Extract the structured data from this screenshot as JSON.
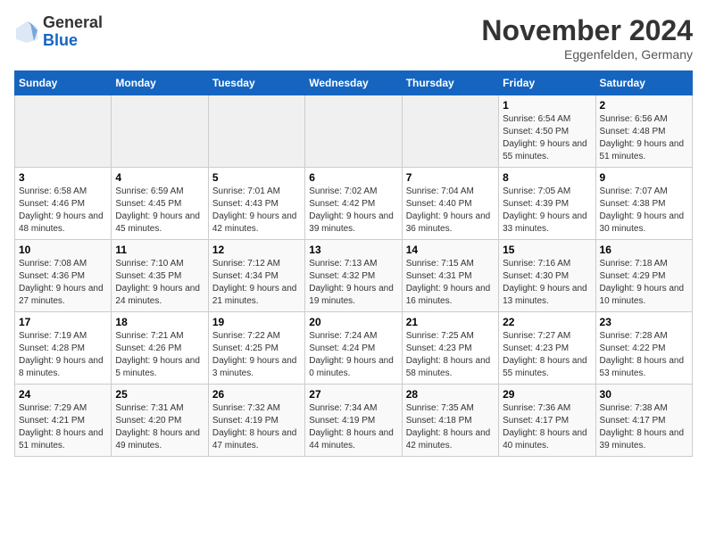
{
  "header": {
    "logo_general": "General",
    "logo_blue": "Blue",
    "month_title": "November 2024",
    "location": "Eggenfelden, Germany"
  },
  "calendar": {
    "days_of_week": [
      "Sunday",
      "Monday",
      "Tuesday",
      "Wednesday",
      "Thursday",
      "Friday",
      "Saturday"
    ],
    "weeks": [
      [
        {
          "day": "",
          "sunrise": "",
          "sunset": "",
          "daylight": ""
        },
        {
          "day": "",
          "sunrise": "",
          "sunset": "",
          "daylight": ""
        },
        {
          "day": "",
          "sunrise": "",
          "sunset": "",
          "daylight": ""
        },
        {
          "day": "",
          "sunrise": "",
          "sunset": "",
          "daylight": ""
        },
        {
          "day": "",
          "sunrise": "",
          "sunset": "",
          "daylight": ""
        },
        {
          "day": "1",
          "sunrise": "Sunrise: 6:54 AM",
          "sunset": "Sunset: 4:50 PM",
          "daylight": "Daylight: 9 hours and 55 minutes."
        },
        {
          "day": "2",
          "sunrise": "Sunrise: 6:56 AM",
          "sunset": "Sunset: 4:48 PM",
          "daylight": "Daylight: 9 hours and 51 minutes."
        }
      ],
      [
        {
          "day": "3",
          "sunrise": "Sunrise: 6:58 AM",
          "sunset": "Sunset: 4:46 PM",
          "daylight": "Daylight: 9 hours and 48 minutes."
        },
        {
          "day": "4",
          "sunrise": "Sunrise: 6:59 AM",
          "sunset": "Sunset: 4:45 PM",
          "daylight": "Daylight: 9 hours and 45 minutes."
        },
        {
          "day": "5",
          "sunrise": "Sunrise: 7:01 AM",
          "sunset": "Sunset: 4:43 PM",
          "daylight": "Daylight: 9 hours and 42 minutes."
        },
        {
          "day": "6",
          "sunrise": "Sunrise: 7:02 AM",
          "sunset": "Sunset: 4:42 PM",
          "daylight": "Daylight: 9 hours and 39 minutes."
        },
        {
          "day": "7",
          "sunrise": "Sunrise: 7:04 AM",
          "sunset": "Sunset: 4:40 PM",
          "daylight": "Daylight: 9 hours and 36 minutes."
        },
        {
          "day": "8",
          "sunrise": "Sunrise: 7:05 AM",
          "sunset": "Sunset: 4:39 PM",
          "daylight": "Daylight: 9 hours and 33 minutes."
        },
        {
          "day": "9",
          "sunrise": "Sunrise: 7:07 AM",
          "sunset": "Sunset: 4:38 PM",
          "daylight": "Daylight: 9 hours and 30 minutes."
        }
      ],
      [
        {
          "day": "10",
          "sunrise": "Sunrise: 7:08 AM",
          "sunset": "Sunset: 4:36 PM",
          "daylight": "Daylight: 9 hours and 27 minutes."
        },
        {
          "day": "11",
          "sunrise": "Sunrise: 7:10 AM",
          "sunset": "Sunset: 4:35 PM",
          "daylight": "Daylight: 9 hours and 24 minutes."
        },
        {
          "day": "12",
          "sunrise": "Sunrise: 7:12 AM",
          "sunset": "Sunset: 4:34 PM",
          "daylight": "Daylight: 9 hours and 21 minutes."
        },
        {
          "day": "13",
          "sunrise": "Sunrise: 7:13 AM",
          "sunset": "Sunset: 4:32 PM",
          "daylight": "Daylight: 9 hours and 19 minutes."
        },
        {
          "day": "14",
          "sunrise": "Sunrise: 7:15 AM",
          "sunset": "Sunset: 4:31 PM",
          "daylight": "Daylight: 9 hours and 16 minutes."
        },
        {
          "day": "15",
          "sunrise": "Sunrise: 7:16 AM",
          "sunset": "Sunset: 4:30 PM",
          "daylight": "Daylight: 9 hours and 13 minutes."
        },
        {
          "day": "16",
          "sunrise": "Sunrise: 7:18 AM",
          "sunset": "Sunset: 4:29 PM",
          "daylight": "Daylight: 9 hours and 10 minutes."
        }
      ],
      [
        {
          "day": "17",
          "sunrise": "Sunrise: 7:19 AM",
          "sunset": "Sunset: 4:28 PM",
          "daylight": "Daylight: 9 hours and 8 minutes."
        },
        {
          "day": "18",
          "sunrise": "Sunrise: 7:21 AM",
          "sunset": "Sunset: 4:26 PM",
          "daylight": "Daylight: 9 hours and 5 minutes."
        },
        {
          "day": "19",
          "sunrise": "Sunrise: 7:22 AM",
          "sunset": "Sunset: 4:25 PM",
          "daylight": "Daylight: 9 hours and 3 minutes."
        },
        {
          "day": "20",
          "sunrise": "Sunrise: 7:24 AM",
          "sunset": "Sunset: 4:24 PM",
          "daylight": "Daylight: 9 hours and 0 minutes."
        },
        {
          "day": "21",
          "sunrise": "Sunrise: 7:25 AM",
          "sunset": "Sunset: 4:23 PM",
          "daylight": "Daylight: 8 hours and 58 minutes."
        },
        {
          "day": "22",
          "sunrise": "Sunrise: 7:27 AM",
          "sunset": "Sunset: 4:23 PM",
          "daylight": "Daylight: 8 hours and 55 minutes."
        },
        {
          "day": "23",
          "sunrise": "Sunrise: 7:28 AM",
          "sunset": "Sunset: 4:22 PM",
          "daylight": "Daylight: 8 hours and 53 minutes."
        }
      ],
      [
        {
          "day": "24",
          "sunrise": "Sunrise: 7:29 AM",
          "sunset": "Sunset: 4:21 PM",
          "daylight": "Daylight: 8 hours and 51 minutes."
        },
        {
          "day": "25",
          "sunrise": "Sunrise: 7:31 AM",
          "sunset": "Sunset: 4:20 PM",
          "daylight": "Daylight: 8 hours and 49 minutes."
        },
        {
          "day": "26",
          "sunrise": "Sunrise: 7:32 AM",
          "sunset": "Sunset: 4:19 PM",
          "daylight": "Daylight: 8 hours and 47 minutes."
        },
        {
          "day": "27",
          "sunrise": "Sunrise: 7:34 AM",
          "sunset": "Sunset: 4:19 PM",
          "daylight": "Daylight: 8 hours and 44 minutes."
        },
        {
          "day": "28",
          "sunrise": "Sunrise: 7:35 AM",
          "sunset": "Sunset: 4:18 PM",
          "daylight": "Daylight: 8 hours and 42 minutes."
        },
        {
          "day": "29",
          "sunrise": "Sunrise: 7:36 AM",
          "sunset": "Sunset: 4:17 PM",
          "daylight": "Daylight: 8 hours and 40 minutes."
        },
        {
          "day": "30",
          "sunrise": "Sunrise: 7:38 AM",
          "sunset": "Sunset: 4:17 PM",
          "daylight": "Daylight: 8 hours and 39 minutes."
        }
      ]
    ]
  }
}
